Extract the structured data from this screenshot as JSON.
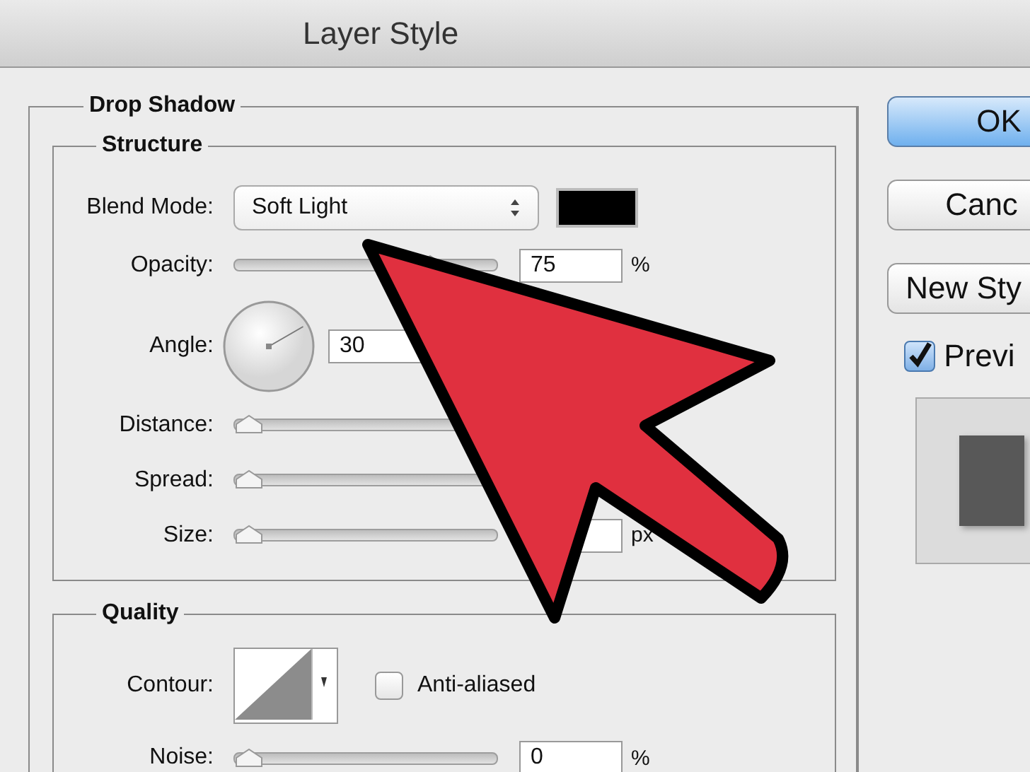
{
  "window": {
    "title": "Layer Style"
  },
  "drop_shadow": {
    "title": "Drop Shadow",
    "structure": {
      "title": "Structure",
      "blend_mode": {
        "label": "Blend Mode:",
        "value": "Soft Light",
        "color": "#000000"
      },
      "opacity": {
        "label": "Opacity:",
        "level": 0.75,
        "value": "75",
        "unit": "%"
      },
      "angle": {
        "label": "Angle:",
        "value": "30"
      },
      "distance": {
        "label": "Distance:",
        "level": 0
      },
      "spread": {
        "label": "Spread:",
        "level": 0
      },
      "size": {
        "label": "Size:",
        "level": 0,
        "unit": "px"
      }
    },
    "quality": {
      "title": "Quality",
      "contour": {
        "label": "Contour:"
      },
      "anti_aliased": {
        "label": "Anti-aliased",
        "checked": false
      },
      "noise": {
        "label": "Noise:",
        "level": 0,
        "value": "0",
        "unit": "%"
      }
    }
  },
  "buttons": [
    {
      "label": "OK",
      "default": true
    },
    {
      "label": "Canc",
      "default": false
    },
    {
      "label": "New Sty",
      "default": false
    }
  ],
  "preview": {
    "label": "Previ",
    "checked": true
  }
}
